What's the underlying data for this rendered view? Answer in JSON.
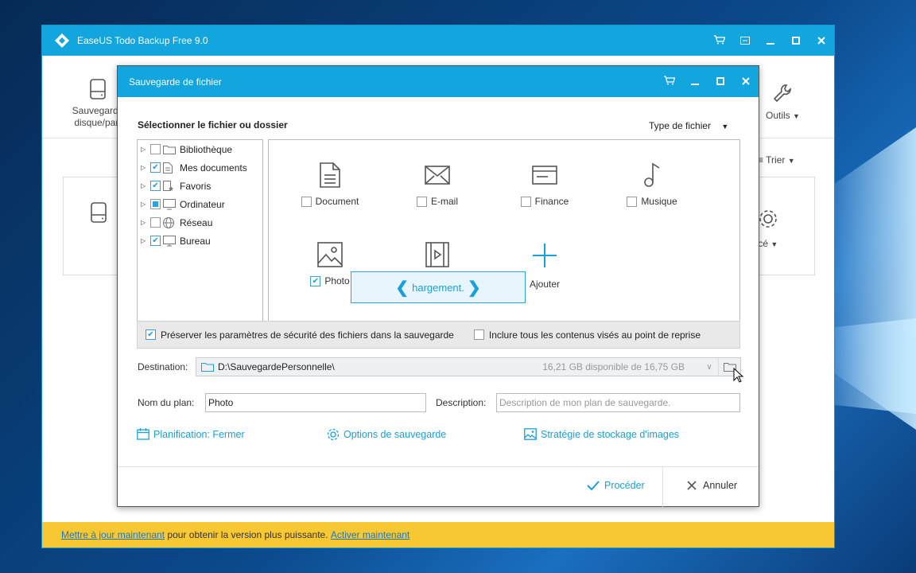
{
  "app": {
    "title": "EaseUS Todo Backup Free 9.0",
    "toolbar": {
      "left_tool_label": "Sauvegarde\ndisque/part",
      "tools_label": "Outils",
      "sort_label": "Trier",
      "advanced_label": "vancé"
    },
    "update_bar": {
      "update_link": "Mettre à jour maintenant",
      "middle_text": " pour obtenir la version plus puissante. ",
      "activate_link": "Activer maintenant"
    }
  },
  "dialog": {
    "title": "Sauvegarde de fichier",
    "section_title": "Sélectionner le fichier ou dossier",
    "file_type_filter": "Type de fichier",
    "tree": [
      {
        "label": "Bibliothèque",
        "state": "unchecked",
        "icon": "folder-icon"
      },
      {
        "label": "Mes documents",
        "state": "checked",
        "icon": "document-icon"
      },
      {
        "label": "Favoris",
        "state": "checked",
        "icon": "favorites-icon"
      },
      {
        "label": "Ordinateur",
        "state": "partial",
        "icon": "computer-icon"
      },
      {
        "label": "Réseau",
        "state": "unchecked",
        "icon": "network-icon"
      },
      {
        "label": "Bureau",
        "state": "checked",
        "icon": "desktop-icon"
      }
    ],
    "file_types": [
      {
        "label": "Document",
        "checked": false,
        "icon": "document-icon"
      },
      {
        "label": "E-mail",
        "checked": false,
        "icon": "email-icon"
      },
      {
        "label": "Finance",
        "checked": false,
        "icon": "finance-icon"
      },
      {
        "label": "Musique",
        "checked": false,
        "icon": "music-icon"
      },
      {
        "label": "Photo",
        "checked": true,
        "icon": "photo-icon"
      },
      {
        "label": "Vidéo",
        "checked": false,
        "icon": "video-icon"
      }
    ],
    "add_label": "Ajouter",
    "loading_text": "Chargement...",
    "loading_visible_text": "hargement.",
    "preserve_security_label": "Préserver les paramètres de sécurité des fichiers dans la sauvegarde",
    "preserve_security_checked": true,
    "include_reparse_label": "Inclure tous les contenus visés au point de reprise",
    "include_reparse_checked": false,
    "destination_label": "Destination:",
    "destination_path": "D:\\SauvegardePersonnelle\\",
    "destination_space": "16,21 GB disponible de 16,75 GB",
    "plan_name_label": "Nom du plan:",
    "plan_name_value": "Photo",
    "description_label": "Description:",
    "description_placeholder": "Description de mon plan de sauvegarde.",
    "schedule_link": "Planification: Fermer",
    "backup_options_link": "Options de sauvegarde",
    "image_storage_link": "Stratégie de stockage d'images",
    "proceed_label": "Procéder",
    "cancel_label": "Annuler"
  },
  "colors": {
    "accent": "#12a5de",
    "link": "#1aa0d8",
    "update_bar": "#f8c832"
  }
}
